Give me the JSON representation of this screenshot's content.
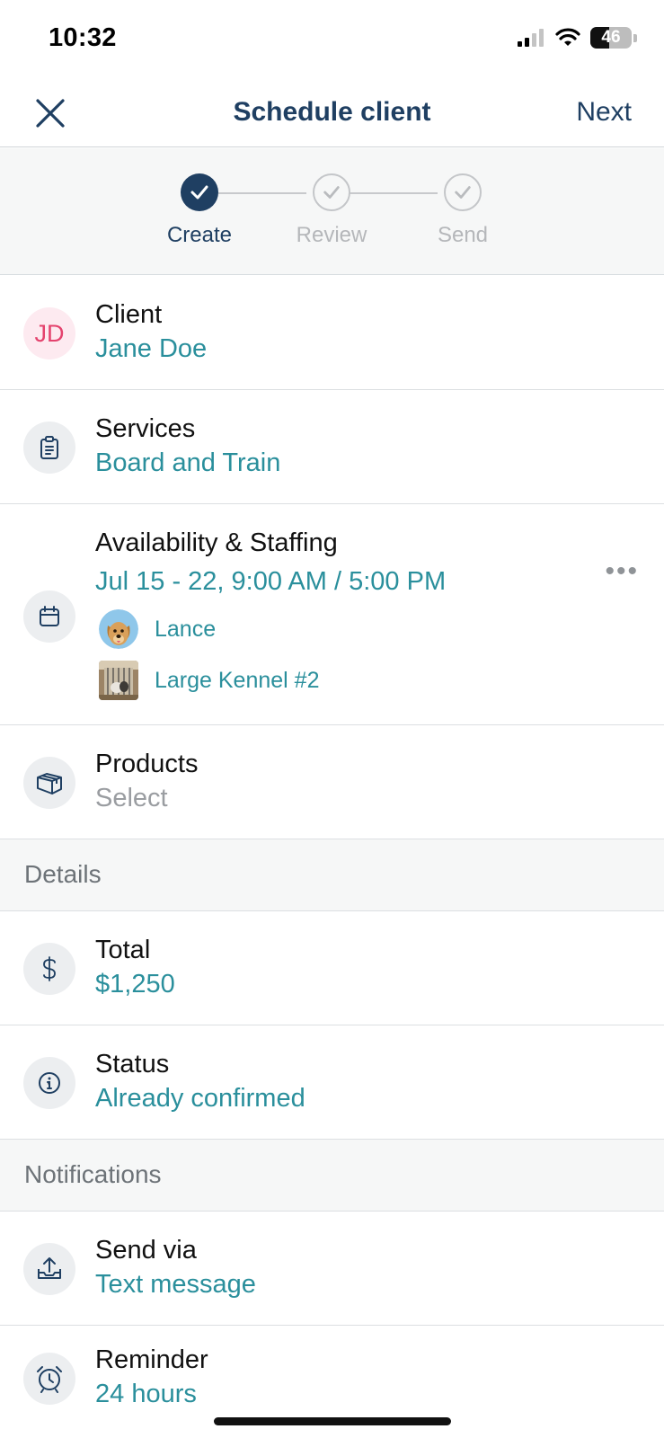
{
  "status_bar": {
    "time": "10:32",
    "battery": "46",
    "battery_level": 0.46
  },
  "nav": {
    "title": "Schedule client",
    "next_label": "Next"
  },
  "stepper": {
    "steps": [
      {
        "label": "Create",
        "state": "done"
      },
      {
        "label": "Review",
        "state": "todo"
      },
      {
        "label": "Send",
        "state": "todo"
      }
    ]
  },
  "client": {
    "title": "Client",
    "value": "Jane Doe",
    "initials": "JD"
  },
  "services": {
    "title": "Services",
    "value": "Board and Train",
    "icon": "clipboard-icon"
  },
  "availability": {
    "title": "Availability & Staffing",
    "value": "Jul 15 - 22, 9:00 AM / 5:00 PM",
    "icon": "calendar-icon",
    "staff": [
      {
        "name": "Lance",
        "icon": "dog-avatar"
      },
      {
        "name": "Large Kennel #2",
        "icon": "kennel-thumbnail"
      }
    ]
  },
  "products": {
    "title": "Products",
    "value": "Select",
    "icon": "box-icon"
  },
  "details_section": {
    "label": "Details"
  },
  "total": {
    "title": "Total",
    "value": "$1,250",
    "icon": "dollar-icon"
  },
  "status": {
    "title": "Status",
    "value": "Already confirmed",
    "icon": "info-icon"
  },
  "notifications_section": {
    "label": "Notifications"
  },
  "send_via": {
    "title": "Send via",
    "value": "Text message",
    "icon": "send-tray-icon"
  },
  "reminder": {
    "title": "Reminder",
    "value": "24 hours",
    "icon": "alarm-clock-icon"
  },
  "colors": {
    "brand": "#1f3f62",
    "accent": "#2a8f9c",
    "initials": "#e4426d"
  }
}
